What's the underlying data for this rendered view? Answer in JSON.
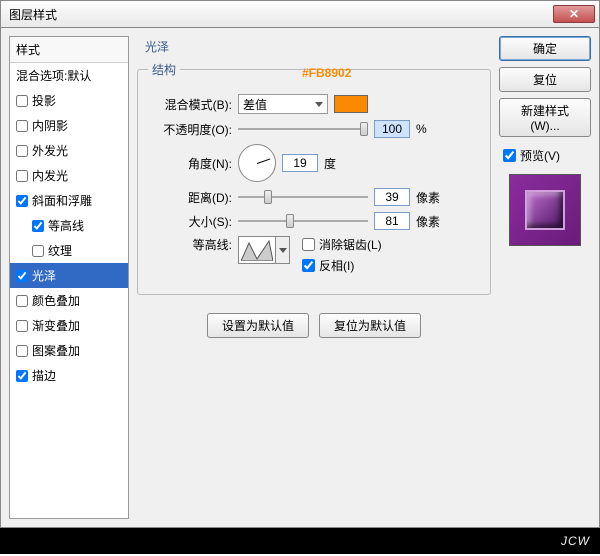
{
  "window": {
    "title": "图层样式"
  },
  "sidebar": {
    "header": "样式",
    "blend_defaults": "混合选项:默认",
    "items": [
      {
        "label": "投影",
        "checked": false
      },
      {
        "label": "内阴影",
        "checked": false
      },
      {
        "label": "外发光",
        "checked": false
      },
      {
        "label": "内发光",
        "checked": false
      },
      {
        "label": "斜面和浮雕",
        "checked": true
      },
      {
        "label": "等高线",
        "checked": true,
        "indent": true
      },
      {
        "label": "纹理",
        "checked": false,
        "indent": true
      },
      {
        "label": "光泽",
        "checked": true,
        "selected": true
      },
      {
        "label": "颜色叠加",
        "checked": false
      },
      {
        "label": "渐变叠加",
        "checked": false
      },
      {
        "label": "图案叠加",
        "checked": false
      },
      {
        "label": "描边",
        "checked": true
      }
    ]
  },
  "panel": {
    "title": "光泽",
    "group": "结构",
    "hex_annotation": "#FB8902",
    "blend_mode_label": "混合模式(B):",
    "blend_mode_value": "差值",
    "opacity_label": "不透明度(O):",
    "opacity_value": "100",
    "opacity_unit": "%",
    "angle_label": "角度(N):",
    "angle_value": "19",
    "angle_unit": "度",
    "distance_label": "距离(D):",
    "distance_value": "39",
    "distance_unit": "像素",
    "size_label": "大小(S):",
    "size_value": "81",
    "size_unit": "像素",
    "contour_label": "等高线:",
    "antialias_label": "消除锯齿(L)",
    "invert_label": "反相(I)",
    "set_default": "设置为默认值",
    "reset_default": "复位为默认值"
  },
  "buttons": {
    "ok": "确定",
    "cancel": "复位",
    "new_style": "新建样式(W)...",
    "preview": "预览(V)"
  },
  "footer": {
    "brand": "JCW"
  }
}
